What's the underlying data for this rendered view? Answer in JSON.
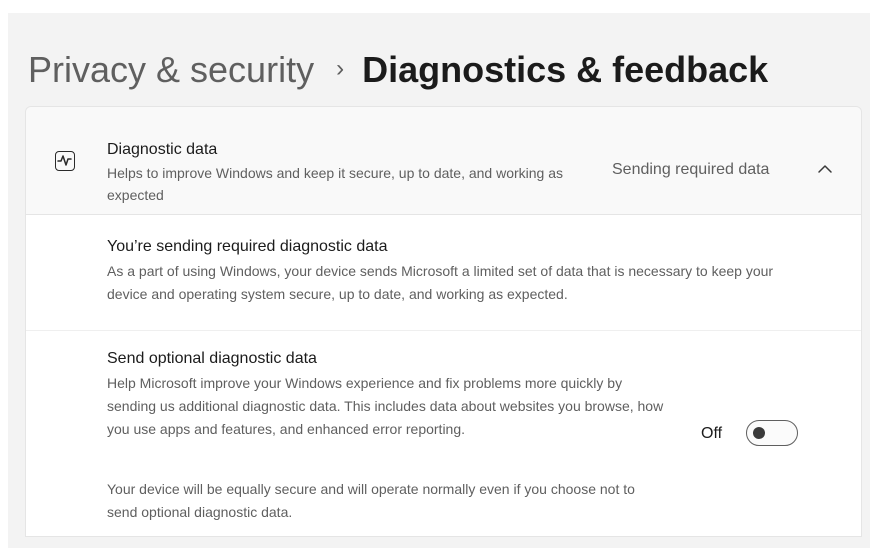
{
  "breadcrumb": {
    "parent": "Privacy & security",
    "separator": "›",
    "current": "Diagnostics & feedback"
  },
  "diagnostic_data": {
    "icon": "activity-monitor-icon",
    "title": "Diagnostic data",
    "description": "Helps to improve Windows and keep it secure, up to date, and working as expected",
    "status": "Sending required data",
    "expanded": true
  },
  "required_section": {
    "title": "You’re sending required diagnostic data",
    "description": "As a part of using Windows, your device sends Microsoft a limited set of data that is necessary to keep your device and operating system secure, up to date, and working as expected."
  },
  "optional_section": {
    "title": "Send optional diagnostic data",
    "description": "Help Microsoft improve your Windows experience and fix problems more quickly by sending us additional diagnostic data. This includes data about websites you browse, how you use apps and features, and enhanced error reporting.",
    "note": "Your device will be equally secure and will operate normally even if you choose not to send optional diagnostic data.",
    "toggle_label": "Off",
    "toggle_on": false
  },
  "colors": {
    "background": "#f3f3f3",
    "card": "#ffffff",
    "text_primary": "#1b1b1b",
    "text_secondary": "#5f5f5f"
  }
}
